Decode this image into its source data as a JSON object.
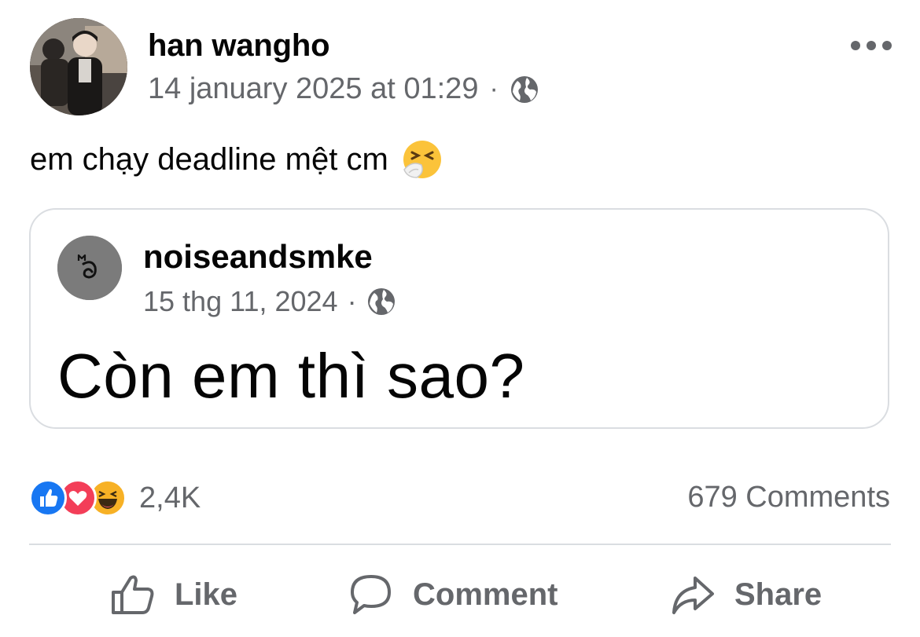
{
  "post": {
    "author": "han wangho",
    "timestamp": "14 january 2025 at 01:29",
    "separator": "·",
    "privacy_icon": "globe-icon",
    "text": "em chạy deadline mệt cm",
    "text_emoji": "sneezing-face-emoji"
  },
  "shared": {
    "author": "noiseandsmke",
    "timestamp": "15 thg 11, 2024",
    "separator": "·",
    "privacy_icon": "globe-icon",
    "text": "Còn em thì sao?"
  },
  "stats": {
    "reaction_icons": [
      "like-reaction-icon",
      "love-reaction-icon",
      "haha-reaction-icon"
    ],
    "reaction_count": "2,4K",
    "comments": "679 Comments"
  },
  "actions": {
    "like": "Like",
    "comment": "Comment",
    "share": "Share"
  },
  "colors": {
    "secondary_text": "#65676b",
    "like_blue": "#1877f2",
    "love_red": "#f33e58",
    "haha_yellow": "#f7b125",
    "divider": "#dadde1"
  }
}
